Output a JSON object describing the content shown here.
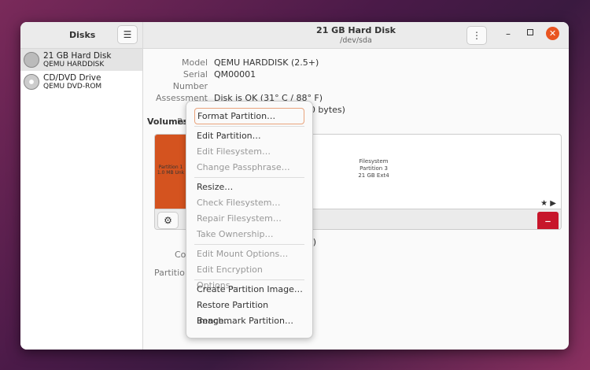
{
  "sidebar": {
    "title": "Disks",
    "devices": [
      {
        "name": "21 GB Hard Disk",
        "sub": "QEMU HARDDISK"
      },
      {
        "name": "CD/DVD Drive",
        "sub": "QEMU DVD-ROM"
      }
    ]
  },
  "header": {
    "title": "21 GB Hard Disk",
    "subtitle": "/dev/sda"
  },
  "props": [
    {
      "k": "Model",
      "v": "QEMU HARDDISK (2.5+)"
    },
    {
      "k": "Serial Number",
      "v": "QM00001"
    },
    {
      "k": "Assessment",
      "v": "Disk is OK (31° C / 88° F)"
    },
    {
      "k": "Size",
      "v": "21 GB (21,474,836,480 bytes)"
    },
    {
      "k": "Partitio",
      "v": ""
    }
  ],
  "volumes": {
    "label": "Volumes",
    "p1": [
      "Partition 1",
      "1.0 MB Unk"
    ],
    "p3": [
      "Filesystem",
      "Partition 3",
      "21 GB Ext4"
    ]
  },
  "lower": {
    "k1": "Co",
    "k2": "Partitio",
    "v1": "s)"
  },
  "menu": [
    {
      "l": "Format Partition…",
      "s": "foc"
    },
    {
      "sep": 1
    },
    {
      "l": "Edit Partition…"
    },
    {
      "l": "Edit Filesystem…",
      "s": "dis"
    },
    {
      "l": "Change Passphrase…",
      "s": "dis"
    },
    {
      "sep": 1
    },
    {
      "l": "Resize…"
    },
    {
      "l": "Check Filesystem…",
      "s": "dis"
    },
    {
      "l": "Repair Filesystem…",
      "s": "dis"
    },
    {
      "l": "Take Ownership…",
      "s": "dis"
    },
    {
      "sep": 1
    },
    {
      "l": "Edit Mount Options…",
      "s": "dis"
    },
    {
      "l": "Edit Encryption Options…",
      "s": "dis"
    },
    {
      "sep": 1
    },
    {
      "l": "Create Partition Image…"
    },
    {
      "l": "Restore Partition Image…"
    },
    {
      "l": "Benchmark Partition…"
    }
  ]
}
